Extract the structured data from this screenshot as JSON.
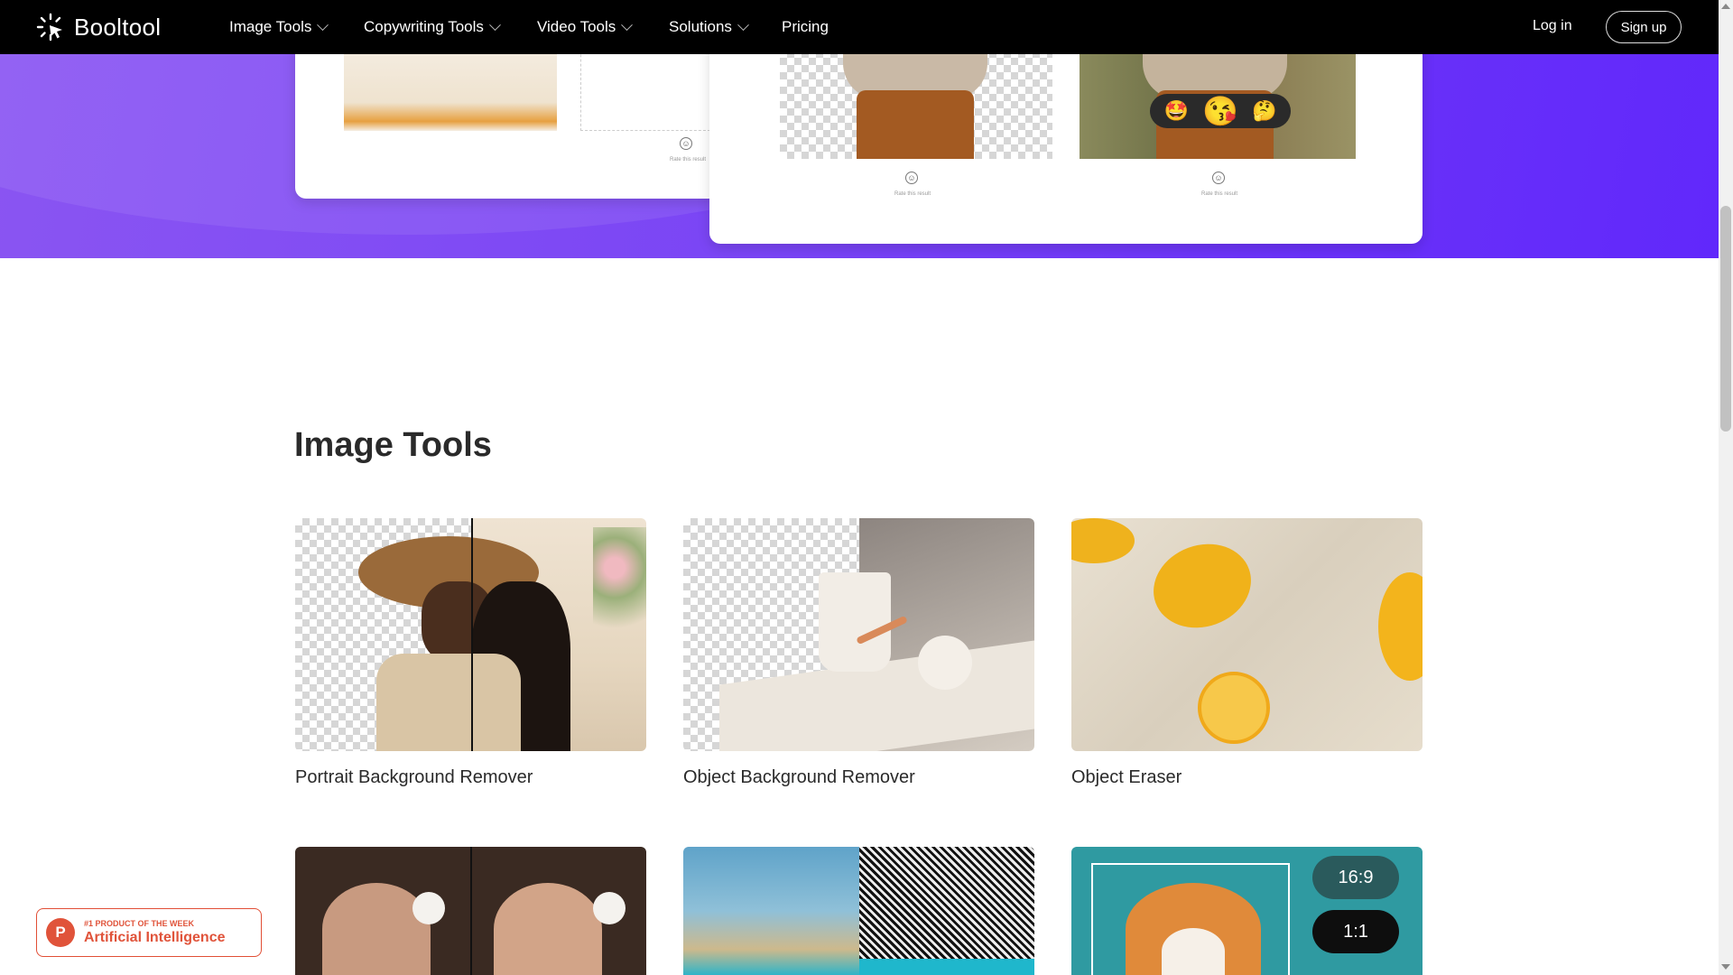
{
  "nav": {
    "brand": "Booltool",
    "items": [
      {
        "label": "Image Tools",
        "has_dropdown": true
      },
      {
        "label": "Copywriting Tools",
        "has_dropdown": true
      },
      {
        "label": "Video Tools",
        "has_dropdown": true
      },
      {
        "label": "Solutions",
        "has_dropdown": true
      },
      {
        "label": "Pricing",
        "has_dropdown": false
      }
    ],
    "login": "Log in",
    "signup": "Sign up"
  },
  "hero": {
    "rate_text": "Rate this result",
    "emojis": [
      "🤩",
      "😘",
      "🤔"
    ]
  },
  "section": {
    "title": "Image Tools",
    "tools": [
      {
        "name": "Portrait Background Remover"
      },
      {
        "name": "Object Background Remover"
      },
      {
        "name": "Object Eraser"
      },
      {
        "name": ""
      },
      {
        "name": ""
      },
      {
        "name": ""
      }
    ],
    "ratio_labels": [
      "16:9",
      "1:1"
    ]
  },
  "badge": {
    "small": "#1 PRODUCT OF THE WEEK",
    "big": "Artificial Intelligence",
    "logo_letter": "P"
  },
  "colors": {
    "hero_start": "#8a55f2",
    "hero_end": "#6128fb",
    "badge": "#e0533a"
  }
}
